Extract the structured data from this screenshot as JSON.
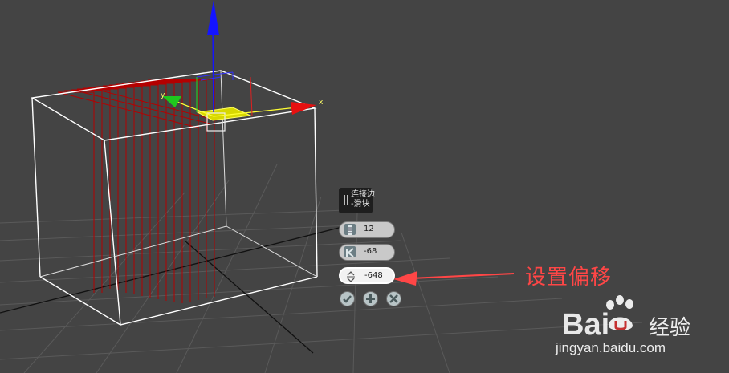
{
  "gizmo": {
    "x_label": "x",
    "y_label": "y"
  },
  "caddy": {
    "title_line1": "连接边",
    "title_line2": "-滑块",
    "segments_value": "12",
    "pinch_value": "-68",
    "slide_value": "-648"
  },
  "annotation": {
    "text": "设置偏移"
  },
  "watermark": {
    "brand": "Bai",
    "brand_suffix": "经验",
    "url": "jingyan.baidu.com"
  },
  "colors": {
    "annotation": "#ff4646",
    "edge_lines": "#b40000",
    "x_axis": "#ff2a2a",
    "y_axis": "#1ec81e",
    "z_axis": "#1010ff"
  }
}
